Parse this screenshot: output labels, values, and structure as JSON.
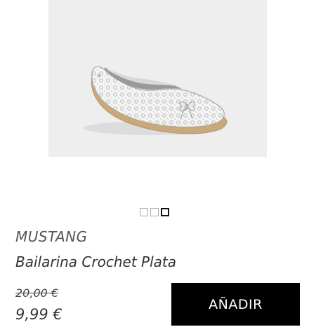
{
  "product": {
    "brand": "MUSTANG",
    "name": "Bailarina Crochet Plata",
    "old_price": "20,00 €",
    "price": "9,99 €",
    "image_icon": "shoe-image",
    "carousel": {
      "count": 3,
      "active_index": 2
    }
  },
  "actions": {
    "add_label": "AÑADIR"
  },
  "colors": {
    "button_bg": "#000000",
    "button_text": "#ffffff",
    "image_bg": "#eeeeee"
  }
}
